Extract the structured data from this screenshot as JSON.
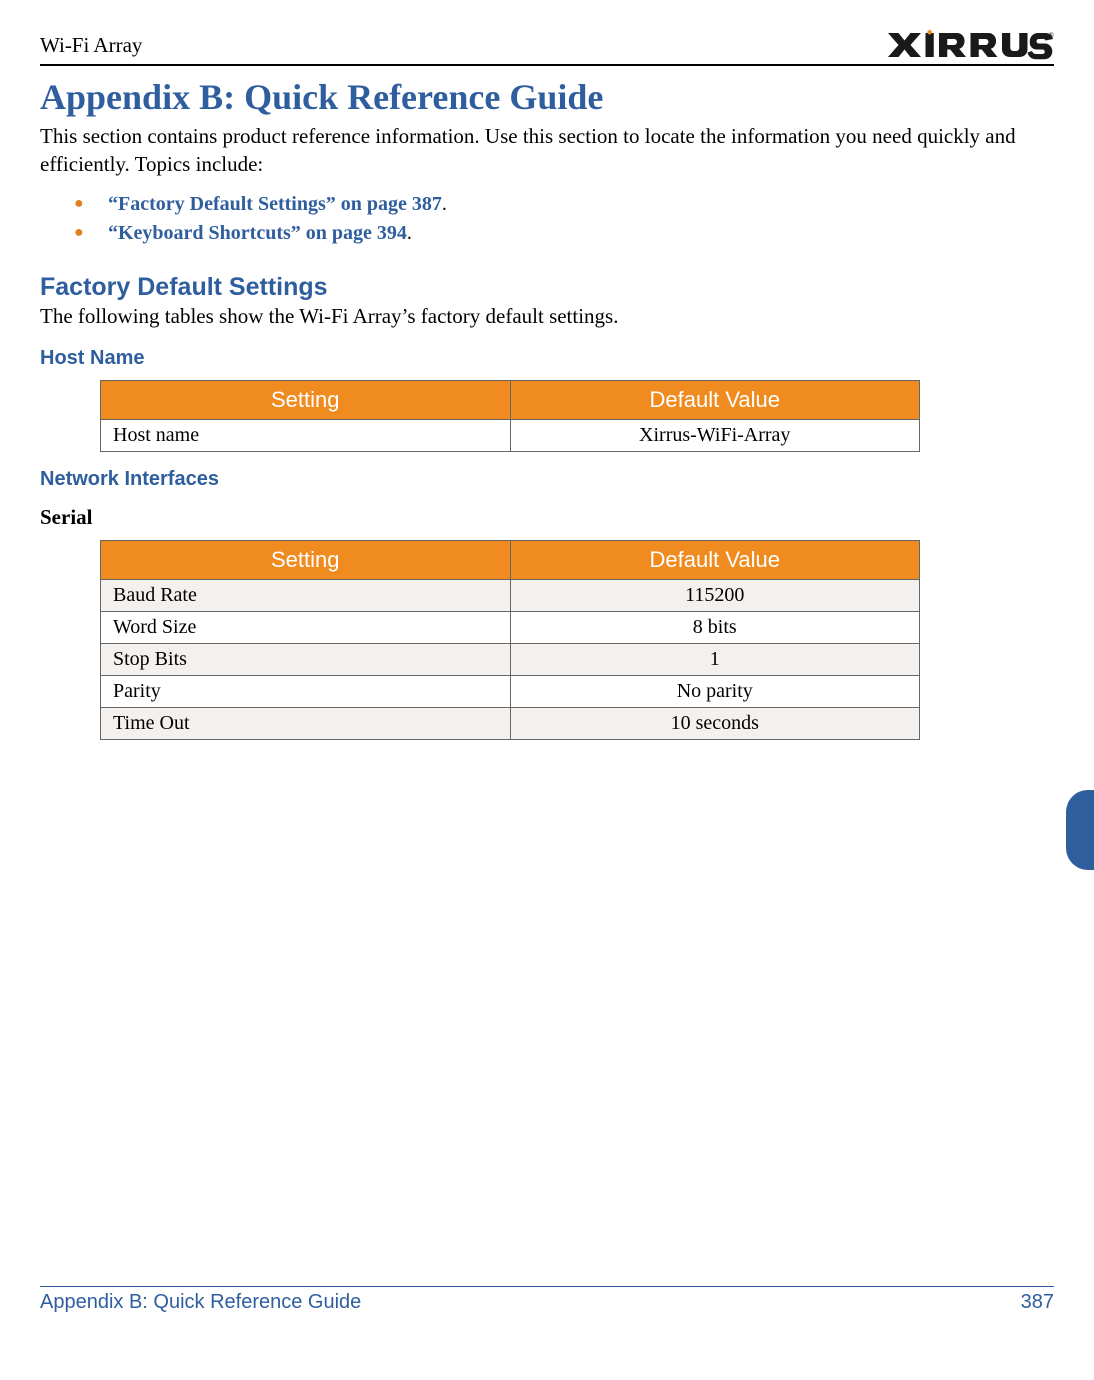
{
  "header": {
    "left": "Wi-Fi Array",
    "logo_text": "XIRRUS"
  },
  "title": "Appendix B: Quick Reference Guide",
  "intro": "This section contains product reference information. Use this section to locate the information you need quickly and efficiently. Topics include:",
  "topics": [
    {
      "link": "“Factory Default Settings” on page 387",
      "suffix": "."
    },
    {
      "link": "“Keyboard Shortcuts” on page 394",
      "suffix": "."
    }
  ],
  "sections": {
    "factory": {
      "heading": "Factory Default Settings",
      "text": "The following tables show the Wi-Fi Array’s factory default settings.",
      "host": {
        "heading": "Host Name",
        "columns": [
          "Setting",
          "Default Value"
        ],
        "rows": [
          {
            "setting": "Host name",
            "value": "Xirrus-WiFi-Array"
          }
        ]
      },
      "network": {
        "heading": "Network Interfaces",
        "serial": {
          "label": "Serial",
          "columns": [
            "Setting",
            "Default Value"
          ],
          "rows": [
            {
              "setting": "Baud Rate",
              "value": "115200"
            },
            {
              "setting": "Word Size",
              "value": "8 bits"
            },
            {
              "setting": "Stop Bits",
              "value": "1"
            },
            {
              "setting": "Parity",
              "value": "No parity"
            },
            {
              "setting": "Time Out",
              "value": "10 seconds"
            }
          ]
        }
      }
    }
  },
  "footer": {
    "left": "Appendix B: Quick Reference Guide",
    "right": "387"
  }
}
